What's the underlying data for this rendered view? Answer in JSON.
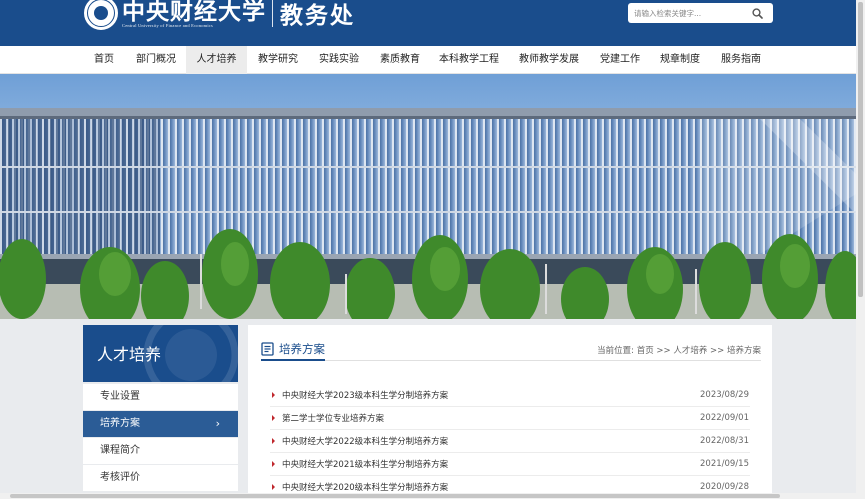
{
  "header": {
    "university_name": "中央财经大学",
    "university_en": "Central University of Finance and Economics",
    "department": "教务处",
    "search_placeholder": "请输入检索关键字..."
  },
  "nav": {
    "items": [
      "首页",
      "部门概况",
      "人才培养",
      "教学研究",
      "实践实验",
      "素质教育",
      "本科教学工程",
      "教师教学发展",
      "党建工作",
      "规章制度",
      "服务指南"
    ],
    "active": "人才培养"
  },
  "sidebar": {
    "title": "人才培养",
    "items": [
      {
        "label": "专业设置"
      },
      {
        "label": "培养方案"
      },
      {
        "label": "课程简介"
      },
      {
        "label": "考核评价"
      }
    ],
    "active": "培养方案"
  },
  "main": {
    "title": "培养方案",
    "breadcrumb": "当前位置: 首页 >> 人才培养 >> 培养方案",
    "rows": [
      {
        "title": "中央财经大学2023级本科生学分制培养方案",
        "date": "2023/08/29"
      },
      {
        "title": "第二学士学位专业培养方案",
        "date": "2022/09/01"
      },
      {
        "title": "中央财经大学2022级本科生学分制培养方案",
        "date": "2022/08/31"
      },
      {
        "title": "中央财经大学2021级本科生学分制培养方案",
        "date": "2021/09/15"
      },
      {
        "title": "中央财经大学2020级本科生学分制培养方案",
        "date": "2020/09/28"
      }
    ]
  },
  "colors": {
    "brand_blue": "#1a4d8c",
    "sidebar_active": "#2b5c96",
    "bullet_red": "#c0282d"
  },
  "icons": {
    "search": "search-icon",
    "document": "document-icon",
    "chevron": "chevron-right-icon",
    "bullet": "triangle-bullet-icon"
  }
}
